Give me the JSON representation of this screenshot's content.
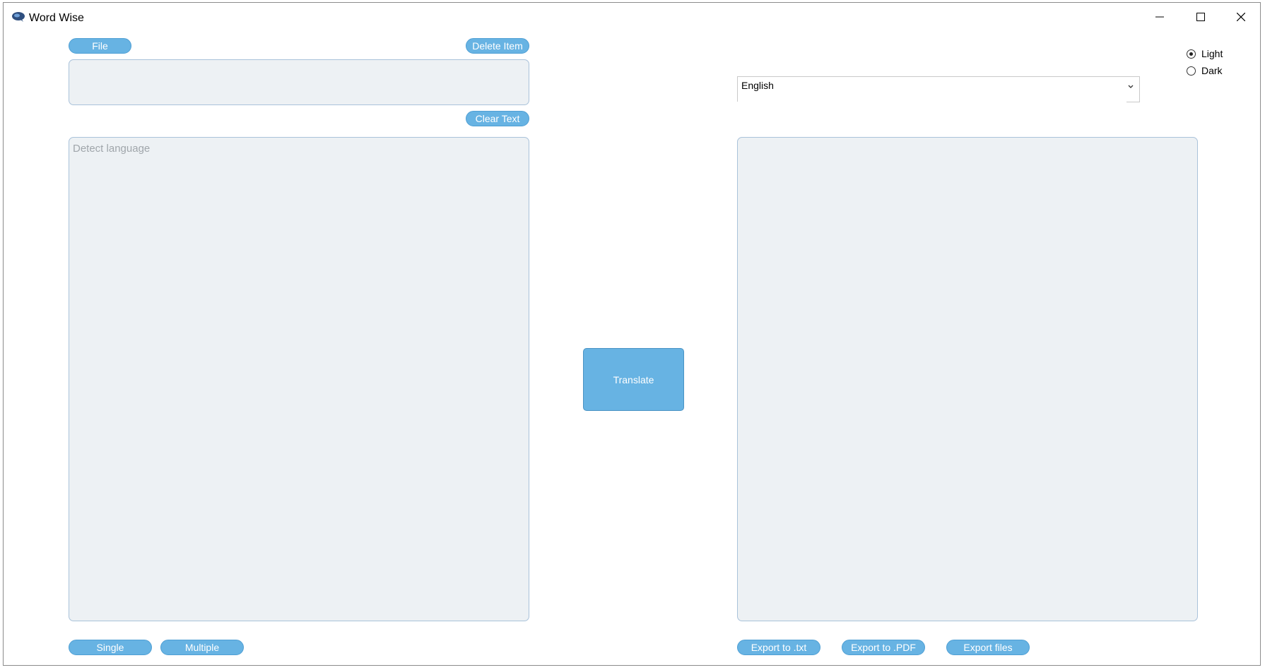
{
  "window": {
    "title": "Word Wise"
  },
  "buttons": {
    "file": "File",
    "delete_item": "Delete Item",
    "clear_text": "Clear Text",
    "translate": "Translate",
    "single": "Single",
    "multiple": "Multiple",
    "export_txt": "Export to .txt",
    "export_pdf": "Export to .PDF",
    "export_files": "Export files"
  },
  "source": {
    "file_list_value": "",
    "input_placeholder": "Detect language",
    "input_value": ""
  },
  "target": {
    "language_selected": "English",
    "output_value": ""
  },
  "theme": {
    "options": [
      {
        "label": "Light",
        "checked": true
      },
      {
        "label": "Dark",
        "checked": false
      }
    ]
  },
  "colors": {
    "accent": "#67b3e3",
    "textbox_bg": "#edf1f4",
    "textbox_border": "#a9c2da"
  },
  "icons": {
    "app": "speech-bubble-icon",
    "minimize": "minimize-icon",
    "maximize": "maximize-icon",
    "close": "close-icon",
    "dropdown": "chevron-down-icon"
  }
}
